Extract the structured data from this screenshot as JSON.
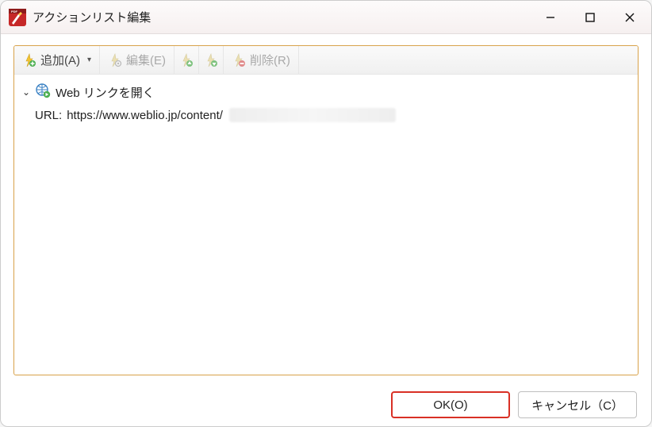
{
  "title": "アクションリスト編集",
  "toolbar": {
    "add_label": "追加(A)",
    "edit_label": "編集(E)",
    "delete_label": "削除(R)"
  },
  "action": {
    "header": "Web リンクを開く",
    "url_label": "URL:",
    "url_value": "https://www.weblio.jp/content/"
  },
  "footer": {
    "ok_label": "OK(O)",
    "cancel_label": "キャンセル（C）"
  }
}
